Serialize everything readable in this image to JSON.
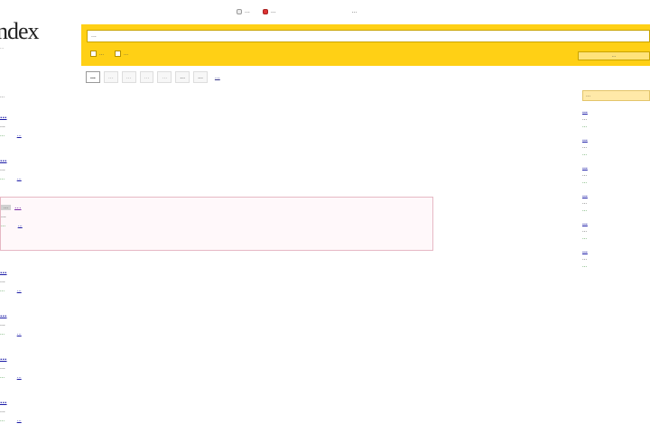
{
  "logo": {
    "word": "ndex",
    "sub": "..."
  },
  "topline": {
    "opt1": "...",
    "opt2": "...",
    "right_link": "..."
  },
  "search": {
    "value": "...",
    "option1": "...",
    "option2": "...",
    "button": "..."
  },
  "tabs": [
    {
      "label": "...",
      "state": "active"
    },
    {
      "label": "...",
      "state": "disabled"
    },
    {
      "label": "...",
      "state": "disabled"
    },
    {
      "label": "...",
      "state": "disabled"
    },
    {
      "label": "...",
      "state": "disabled"
    },
    {
      "label": "...",
      "state": "dark"
    },
    {
      "label": "...",
      "state": "dark"
    },
    {
      "label": "...",
      "state": "more"
    }
  ],
  "found_text": "...",
  "results": [
    {
      "title": "...",
      "snippet": "...",
      "url": "...",
      "extra": "..."
    },
    {
      "title": "...",
      "snippet": "...",
      "url": "...",
      "extra": "..."
    }
  ],
  "ad": {
    "mark": "...",
    "title": "...",
    "snippet": "...",
    "url": "...",
    "extra": "..."
  },
  "results2": [
    {
      "title": "...",
      "snippet": "...",
      "url": "...",
      "extra": "..."
    },
    {
      "title": "...",
      "snippet": "...",
      "url": "...",
      "extra": "..."
    },
    {
      "title": "...",
      "snippet": "...",
      "url": "...",
      "extra": "..."
    },
    {
      "title": "...",
      "snippet": "...",
      "url": "...",
      "extra": "..."
    }
  ],
  "sidebar": {
    "head": "...",
    "items": [
      {
        "title": "...",
        "text": "...",
        "url": "..."
      },
      {
        "title": "...",
        "text": "...",
        "url": "..."
      },
      {
        "title": "...",
        "text": "...",
        "url": "..."
      },
      {
        "title": "...",
        "text": "...",
        "url": "..."
      },
      {
        "title": "...",
        "text": "...",
        "url": "..."
      },
      {
        "title": "...",
        "text": "...",
        "url": "..."
      }
    ]
  },
  "colors": {
    "accent": "#ffd015",
    "link": "#1a1aa6",
    "url": "#2a8a2a",
    "ad_border": "#e6b8c4"
  }
}
